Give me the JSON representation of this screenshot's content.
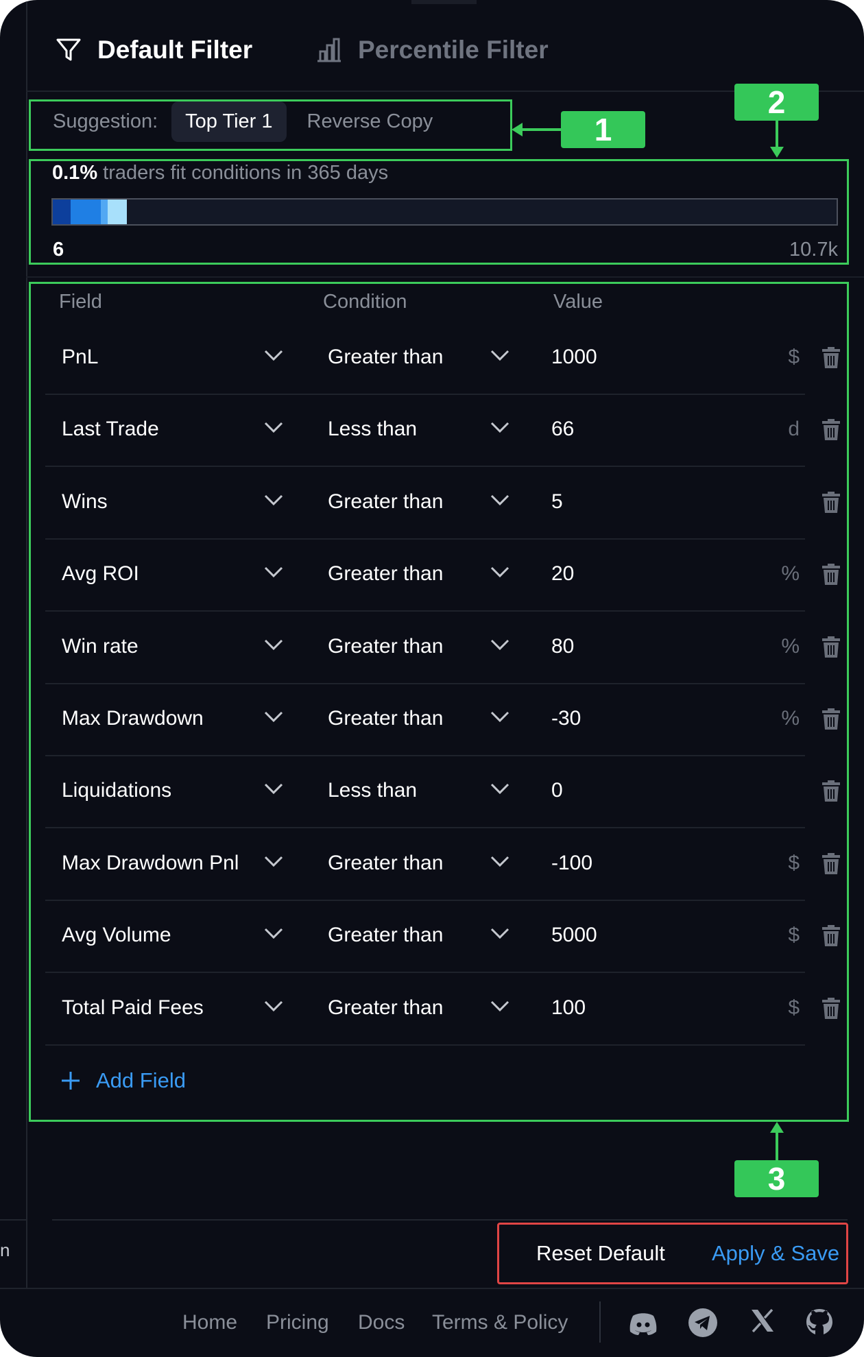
{
  "header": {
    "tabs": [
      {
        "label": "Default Filter",
        "icon": "filter-icon",
        "active": true
      },
      {
        "label": "Percentile Filter",
        "icon": "bar-chart-icon",
        "active": false
      }
    ]
  },
  "suggestion": {
    "label": "Suggestion:",
    "chips": [
      {
        "label": "Top Tier 1",
        "active": true
      },
      {
        "label": "Reverse Copy",
        "active": false
      }
    ]
  },
  "markers": {
    "one": "1",
    "two": "2",
    "three": "3"
  },
  "stats": {
    "percent": "0.1%",
    "text": "traders fit conditions in 365 days",
    "min_label": "6",
    "max_label": "10.7k",
    "bar_fill_fraction": 0.1
  },
  "table": {
    "headers": {
      "field": "Field",
      "condition": "Condition",
      "value": "Value"
    },
    "rows": [
      {
        "field": "PnL",
        "condition": "Greater than",
        "value": "1000",
        "unit": "$"
      },
      {
        "field": "Last Trade",
        "condition": "Less than",
        "value": "66",
        "unit": "d"
      },
      {
        "field": "Wins",
        "condition": "Greater than",
        "value": "5",
        "unit": ""
      },
      {
        "field": "Avg ROI",
        "condition": "Greater than",
        "value": "20",
        "unit": "%"
      },
      {
        "field": "Win rate",
        "condition": "Greater than",
        "value": "80",
        "unit": "%"
      },
      {
        "field": "Max Drawdown",
        "condition": "Greater than",
        "value": "-30",
        "unit": "%"
      },
      {
        "field": "Liquidations",
        "condition": "Less than",
        "value": "0",
        "unit": ""
      },
      {
        "field": "Max Drawdown Pnl",
        "condition": "Greater than",
        "value": "-100",
        "unit": "$"
      },
      {
        "field": "Avg Volume",
        "condition": "Greater than",
        "value": "5000",
        "unit": "$"
      },
      {
        "field": "Total Paid Fees",
        "condition": "Greater than",
        "value": "100",
        "unit": "$"
      }
    ],
    "add_field_label": "Add Field"
  },
  "actions": {
    "reset": "Reset Default",
    "apply": "Apply & Save"
  },
  "left_rail_fragment": "n",
  "footer": {
    "links": [
      "Home",
      "Pricing",
      "Docs",
      "Terms & Policy"
    ],
    "social_icons": [
      "discord-icon",
      "telegram-icon",
      "x-icon",
      "github-icon"
    ]
  },
  "colors": {
    "background": "#0b0d16",
    "annotation_green": "#3ccb5b",
    "annotation_red": "#e04545",
    "accent_blue": "#3a9bf4",
    "bar_colors": [
      "#0d3f9c",
      "#1f7fe4",
      "#52a8f3",
      "#a8e0fb"
    ]
  }
}
